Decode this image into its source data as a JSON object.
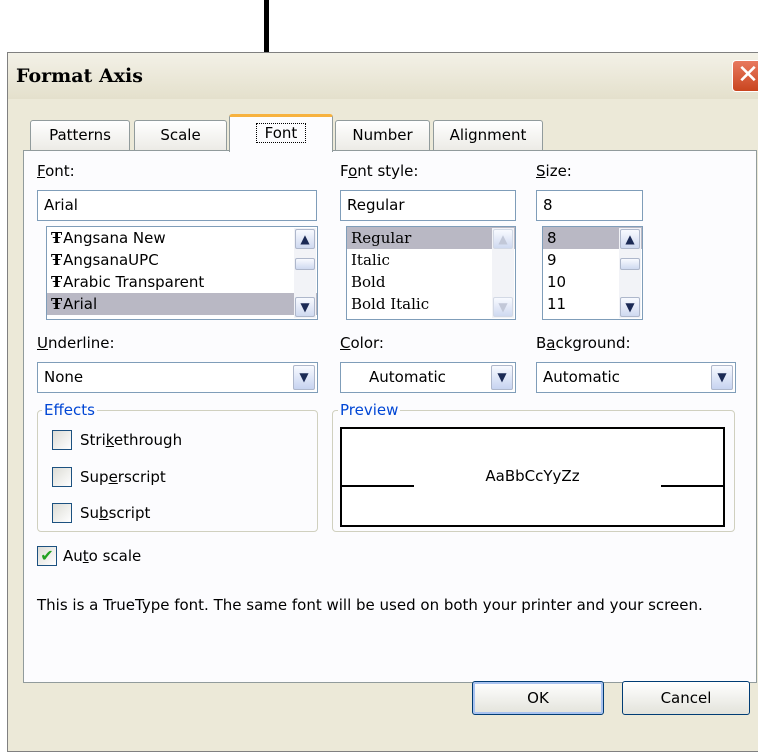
{
  "dialog": {
    "title": "Format Axis"
  },
  "tabs": [
    {
      "label": "Patterns"
    },
    {
      "label": "Scale"
    },
    {
      "label": "Font"
    },
    {
      "label": "Number"
    },
    {
      "label": "Alignment"
    }
  ],
  "active_tab": "Font",
  "font": {
    "label_pre": "",
    "label_ul": "F",
    "label_post": "ont:",
    "value": "Arial",
    "items": [
      "Angsana New",
      "AngsanaUPC",
      "Arabic Transparent",
      "Arial"
    ],
    "selected": "Arial",
    "truetype_glyph": "Ŧ"
  },
  "font_style": {
    "label_pre": "F",
    "label_ul": "o",
    "label_post": "nt style:",
    "value": "Regular",
    "items": [
      "Regular",
      "Italic",
      "Bold",
      "Bold Italic"
    ],
    "selected": "Regular"
  },
  "size": {
    "label_pre": "",
    "label_ul": "S",
    "label_post": "ize:",
    "value": "8",
    "items": [
      "8",
      "9",
      "10",
      "11"
    ],
    "selected": "8"
  },
  "underline": {
    "label_pre": "",
    "label_ul": "U",
    "label_post": "nderline:",
    "value": "None"
  },
  "color": {
    "label_pre": "",
    "label_ul": "C",
    "label_post": "olor:",
    "value": "Automatic"
  },
  "background": {
    "label_pre": "B",
    "label_ul": "a",
    "label_post": "ckground:",
    "value": "Automatic"
  },
  "effects": {
    "legend": "Effects",
    "strikethrough": {
      "pre": "Stri",
      "ul": "k",
      "post": "ethrough",
      "checked": false
    },
    "superscript": {
      "pre": "Sup",
      "ul": "e",
      "post": "rscript",
      "checked": false
    },
    "subscript": {
      "pre": "Su",
      "ul": "b",
      "post": "script",
      "checked": false
    }
  },
  "preview": {
    "legend": "Preview",
    "sample": "AaBbCcYyZz"
  },
  "auto_scale": {
    "pre": "Au",
    "ul": "t",
    "post": "o scale",
    "checked": true
  },
  "info_text": "This is a TrueType font.  The same font will be used on both your printer and your screen.",
  "buttons": {
    "ok": "OK",
    "cancel": "Cancel"
  },
  "glyphs": {
    "close": "✕",
    "scroll_up": "▲",
    "scroll_down": "▼",
    "dropdown": "▼",
    "check": "✔"
  },
  "colors": {
    "dialog_bg": "#ece9d8",
    "panel_bg": "#fcfcfe",
    "tab_highlight": "#f7b23f",
    "group_legend": "#0046d5",
    "selection": "#b9b8c4",
    "checkmark": "#21a121"
  }
}
